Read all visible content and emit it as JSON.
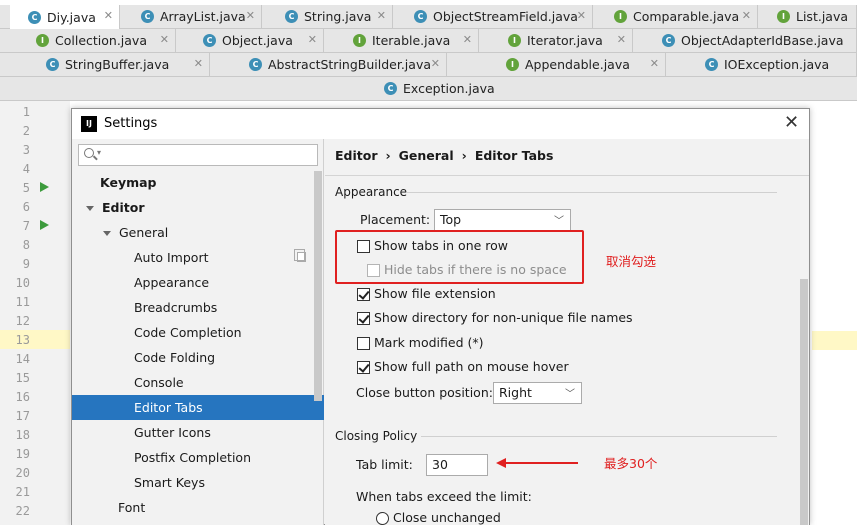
{
  "editor_tabs": {
    "row1": [
      {
        "label": "Diy.java",
        "icon": "c",
        "active": true
      },
      {
        "label": "ArrayList.java",
        "icon": "c"
      },
      {
        "label": "String.java",
        "icon": "c"
      },
      {
        "label": "ObjectStreamField.java",
        "icon": "c"
      },
      {
        "label": "Comparable.java",
        "icon": "i"
      },
      {
        "label": "List.java",
        "icon": "i"
      }
    ],
    "row2": [
      {
        "label": "Collection.java",
        "icon": "i"
      },
      {
        "label": "Object.java",
        "icon": "c"
      },
      {
        "label": "Iterable.java",
        "icon": "i"
      },
      {
        "label": "Iterator.java",
        "icon": "i"
      },
      {
        "label": "ObjectAdapterIdBase.java",
        "icon": "c"
      }
    ],
    "row3": [
      {
        "label": "StringBuffer.java",
        "icon": "c"
      },
      {
        "label": "AbstractStringBuilder.java",
        "icon": "c"
      },
      {
        "label": "Appendable.java",
        "icon": "i"
      },
      {
        "label": "IOException.java",
        "icon": "ex"
      }
    ],
    "row4": [
      {
        "label": "Exception.java",
        "icon": "ex"
      }
    ]
  },
  "gutter": {
    "line_numbers": [
      "1",
      "2",
      "3",
      "4",
      "5",
      "6",
      "7",
      "8",
      "9",
      "10",
      "11",
      "12",
      "13",
      "14",
      "15",
      "16",
      "17",
      "18",
      "19",
      "20",
      "21",
      "22"
    ]
  },
  "dialog": {
    "title": "Settings",
    "close_glyph": "✕",
    "search": {
      "placeholder": ""
    },
    "tree": {
      "keymap": "Keymap",
      "editor": "Editor",
      "general": "General",
      "items": [
        "Auto Import",
        "Appearance",
        "Breadcrumbs",
        "Code Completion",
        "Code Folding",
        "Console",
        "Editor Tabs",
        "Gutter Icons",
        "Postfix Completion",
        "Smart Keys"
      ],
      "font": "Font"
    },
    "breadcrumb": {
      "part1": "Editor",
      "part2": "General",
      "part3": "Editor Tabs",
      "sep": "›"
    },
    "appearance": {
      "section_title": "Appearance",
      "placement_label": "Placement:",
      "placement_value": "Top",
      "show_tabs_one_row": "Show tabs in one row",
      "hide_tabs_no_space": "Hide tabs if there is no space",
      "show_file_extension": "Show file extension",
      "show_directory": "Show directory for non-unique file names",
      "mark_modified": "Mark modified (*)",
      "show_full_path": "Show full path on mouse hover",
      "close_button_label": "Close button position:",
      "close_button_value": "Right"
    },
    "closing_policy": {
      "section_title": "Closing Policy",
      "tab_limit_label": "Tab limit:",
      "tab_limit_value": "30",
      "exceed_label": "When tabs exceed the limit:",
      "close_unchanged": "Close unchanged"
    }
  },
  "annotations": {
    "uncheck_note": "取消勾选",
    "max_note": "最多30个"
  },
  "colors": {
    "selected_bg": "#2675bf",
    "annotation_red": "#e02020"
  }
}
